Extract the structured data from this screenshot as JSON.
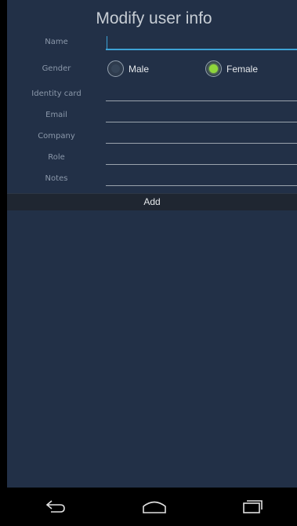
{
  "header": {
    "title": "Modify user info"
  },
  "form": {
    "name_label": "Name",
    "gender_label": "Gender",
    "gender_options": [
      {
        "label": "Male",
        "checked": false
      },
      {
        "label": "Female",
        "checked": true
      }
    ],
    "identity_label": "Identity card",
    "email_label": "Email",
    "company_label": "Company",
    "role_label": "Role",
    "notes_label": "Notes",
    "add_label": "Add"
  },
  "navbar": {
    "icons": [
      "back-icon",
      "home-icon",
      "recent-apps-icon"
    ]
  },
  "colors": {
    "background": "#223047",
    "accent": "#3da2d6",
    "radio_selected": "#8fd63b"
  }
}
